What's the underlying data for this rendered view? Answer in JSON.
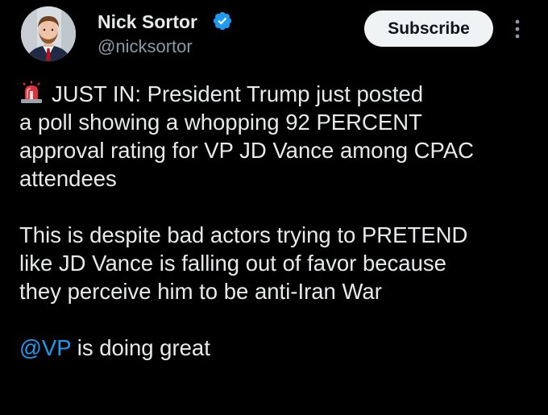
{
  "author": {
    "name": "Nick Sortor",
    "handle": "@nicksortor",
    "verified": true,
    "verified_color": "#1d9bf0"
  },
  "actions": {
    "subscribe_label": "Subscribe",
    "more_icon": "more-vertical-icon"
  },
  "tweet": {
    "siren_icon": "police-siren-emoji",
    "line1": "JUST IN: President Trump just posted",
    "line2": "a poll showing a whopping 92 PERCENT",
    "line3": "approval rating for VP JD Vance among CPAC",
    "line4": "attendees",
    "line5": "This is despite bad actors trying to PRETEND",
    "line6": "like JD Vance is falling out of favor because",
    "line7": "they perceive him to be anti-Iran War",
    "mention": "@VP",
    "mention_rest": " is doing great"
  },
  "colors": {
    "background": "#000000",
    "text": "#e7e9ea",
    "secondary_text": "#8b98a5",
    "link": "#1d9bf0",
    "button_bg": "#eff3f4"
  }
}
